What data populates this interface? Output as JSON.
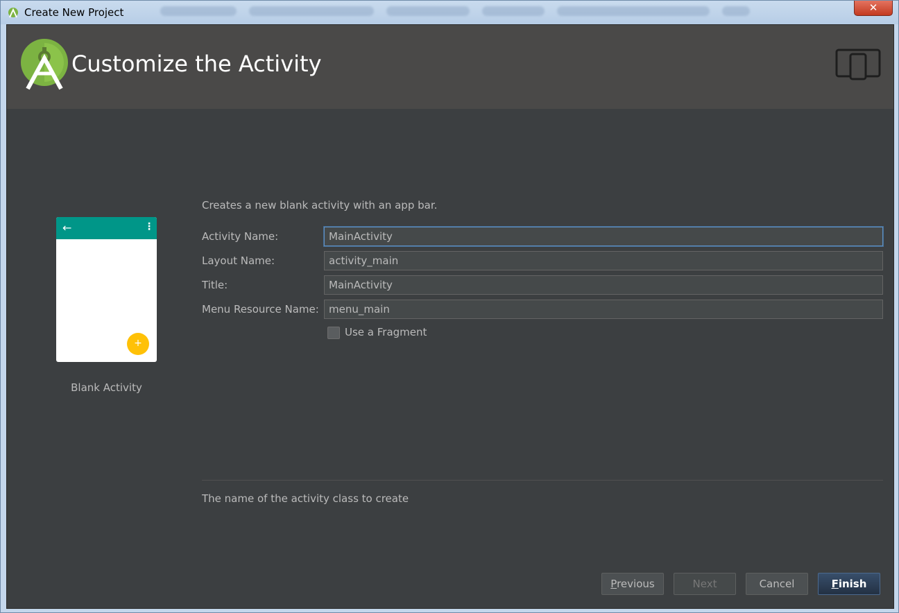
{
  "window": {
    "title": "Create New Project",
    "close_glyph": "✕"
  },
  "header": {
    "title": "Customize the Activity",
    "logo_icon": "android-studio-logo",
    "device_icon": "tablet-phone-icon"
  },
  "preview": {
    "back_glyph": "←",
    "menu_glyph": "⋮",
    "fab_glyph": "+",
    "template_name": "Blank Activity",
    "colors": {
      "appbar": "#009688",
      "fab": "#ffc107"
    }
  },
  "form": {
    "description": "Creates a new blank activity with an app bar.",
    "fields": [
      {
        "label": "Activity Name:",
        "value": "MainActivity"
      },
      {
        "label": "Layout Name:",
        "value": "activity_main"
      },
      {
        "label": "Title:",
        "value": "MainActivity"
      },
      {
        "label": "Menu Resource Name:",
        "value": "menu_main"
      }
    ],
    "fragment_checkbox": {
      "label": "Use a Fragment",
      "checked": false
    },
    "help_text": "The name of the activity class to create"
  },
  "buttons": {
    "previous_first": "P",
    "previous_rest": "revious",
    "next": "Next",
    "cancel": "Cancel",
    "finish_first": "F",
    "finish_rest": "inish"
  }
}
